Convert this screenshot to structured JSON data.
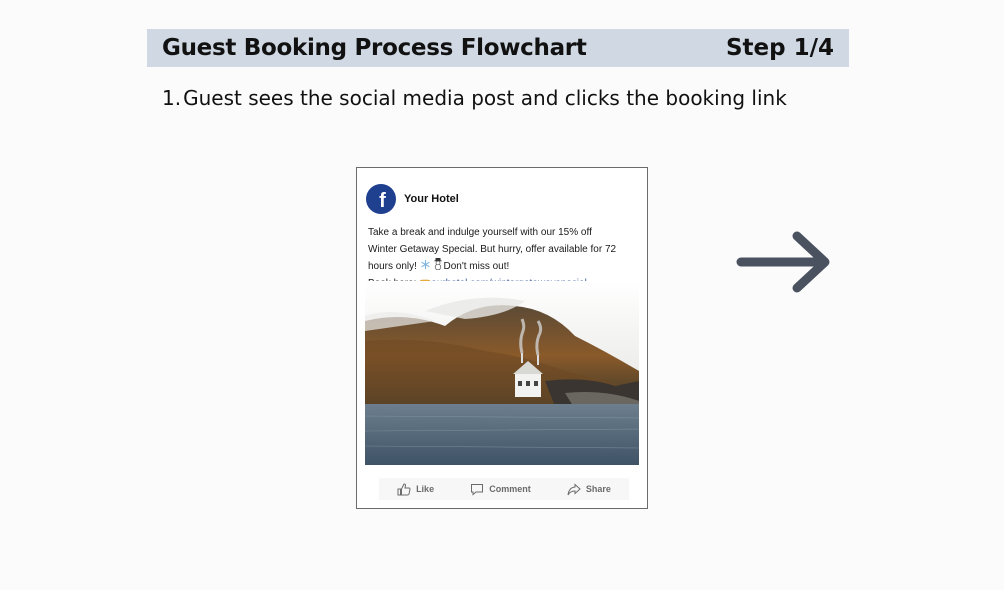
{
  "header": {
    "title": "Guest Booking Process Flowchart",
    "step": "Step 1/4"
  },
  "step_description": {
    "number": "1.",
    "text": "Guest sees the social media post and clicks the booking link"
  },
  "post": {
    "platform_icon": "facebook-icon",
    "author": "Your Hotel",
    "body_line1": "Take a break and indulge yourself with our 15% off",
    "body_line2": "Winter Getaway Special. But hurry, offer available for 72",
    "body_line3_prefix": "hours only! ",
    "body_line3_suffix": "Don't miss out!",
    "book_prefix": "Book here: ",
    "link": "ourhotel.com/wintergetawayspecial",
    "actions": {
      "like": "Like",
      "comment": "Comment",
      "share": "Share"
    }
  },
  "colors": {
    "title_bar": "#cfd8e3",
    "facebook_blue": "#1f3f8f",
    "arrow": "#4a5260",
    "link": "#3a5a9c"
  },
  "icons": [
    "facebook-icon",
    "snowflake-icon",
    "snowman-icon",
    "pointing-hand-icon",
    "like-icon",
    "comment-icon",
    "share-icon",
    "right-arrow-icon"
  ]
}
